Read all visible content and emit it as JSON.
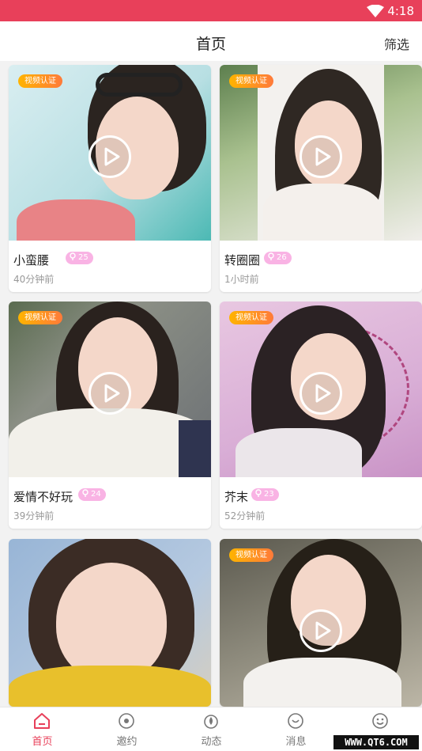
{
  "status_bar": {
    "time": "4:18"
  },
  "header": {
    "title": "首页",
    "filter_label": "筛选"
  },
  "cards": [
    {
      "name": "小蛮腰",
      "age": "25",
      "time_ago": "40分钟前",
      "badge": "视频认证"
    },
    {
      "name": "转圈圈",
      "age": "26",
      "time_ago": "1小时前",
      "badge": "视频认证"
    },
    {
      "name": "爱情不好玩",
      "age": "24",
      "time_ago": "39分钟前",
      "badge": "视频认证"
    },
    {
      "name": "芥末",
      "age": "23",
      "time_ago": "52分钟前",
      "badge": "视频认证"
    },
    {
      "badge": ""
    },
    {
      "badge": "视频认证"
    }
  ],
  "tabs": [
    {
      "label": "首页",
      "icon": "home-icon"
    },
    {
      "label": "邀约",
      "icon": "target-icon"
    },
    {
      "label": "动态",
      "icon": "flame-icon"
    },
    {
      "label": "消息",
      "icon": "chat-icon"
    },
    {
      "label": "",
      "icon": "smile-icon"
    }
  ],
  "watermark": "WWW.QT6.COM",
  "colors": {
    "accent": "#e8405a",
    "badge": "#ff9a1f",
    "age_tag": "#f9b3e4"
  }
}
